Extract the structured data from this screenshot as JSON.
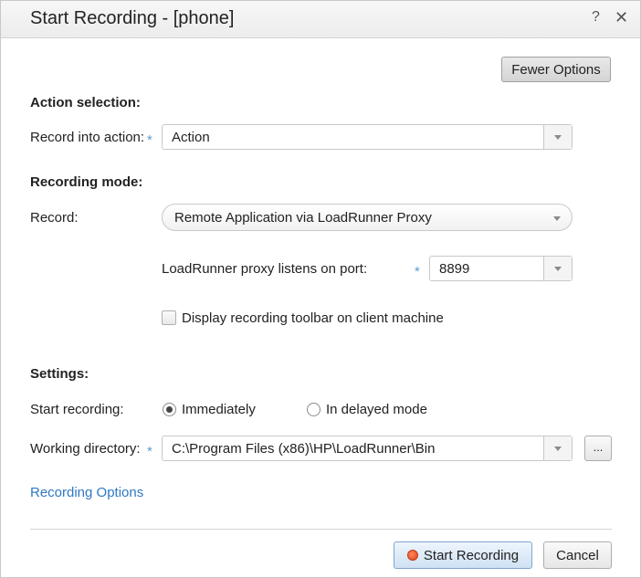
{
  "dialog": {
    "title": "Start Recording - [phone]",
    "help_label": "?",
    "close_label": "✕"
  },
  "options_toggle": "Fewer Options",
  "action_selection": {
    "heading": "Action selection:",
    "record_into_label": "Record into action:",
    "record_into_value": "Action"
  },
  "recording_mode": {
    "heading": "Recording mode:",
    "record_label": "Record:",
    "record_value": "Remote Application via LoadRunner Proxy",
    "proxy_port_label": "LoadRunner proxy listens on port:",
    "proxy_port_value": "8899",
    "display_toolbar_label": "Display recording toolbar on client machine",
    "display_toolbar_checked": false
  },
  "settings": {
    "heading": "Settings:",
    "start_recording_label": "Start recording:",
    "immediately_label": "Immediately",
    "delayed_label": "In delayed mode",
    "selected_mode": "Immediately",
    "working_dir_label": "Working directory:",
    "working_dir_value": "C:\\Program Files (x86)\\HP\\LoadRunner\\Bin",
    "browse_label": "..."
  },
  "recording_options_link": "Recording Options",
  "footer": {
    "start_label": "Start Recording",
    "cancel_label": "Cancel"
  },
  "required_marker": "*",
  "colors": {
    "required_star": "#5b9bd5",
    "link": "#2f78c4",
    "record_dot": "#e0401a"
  }
}
